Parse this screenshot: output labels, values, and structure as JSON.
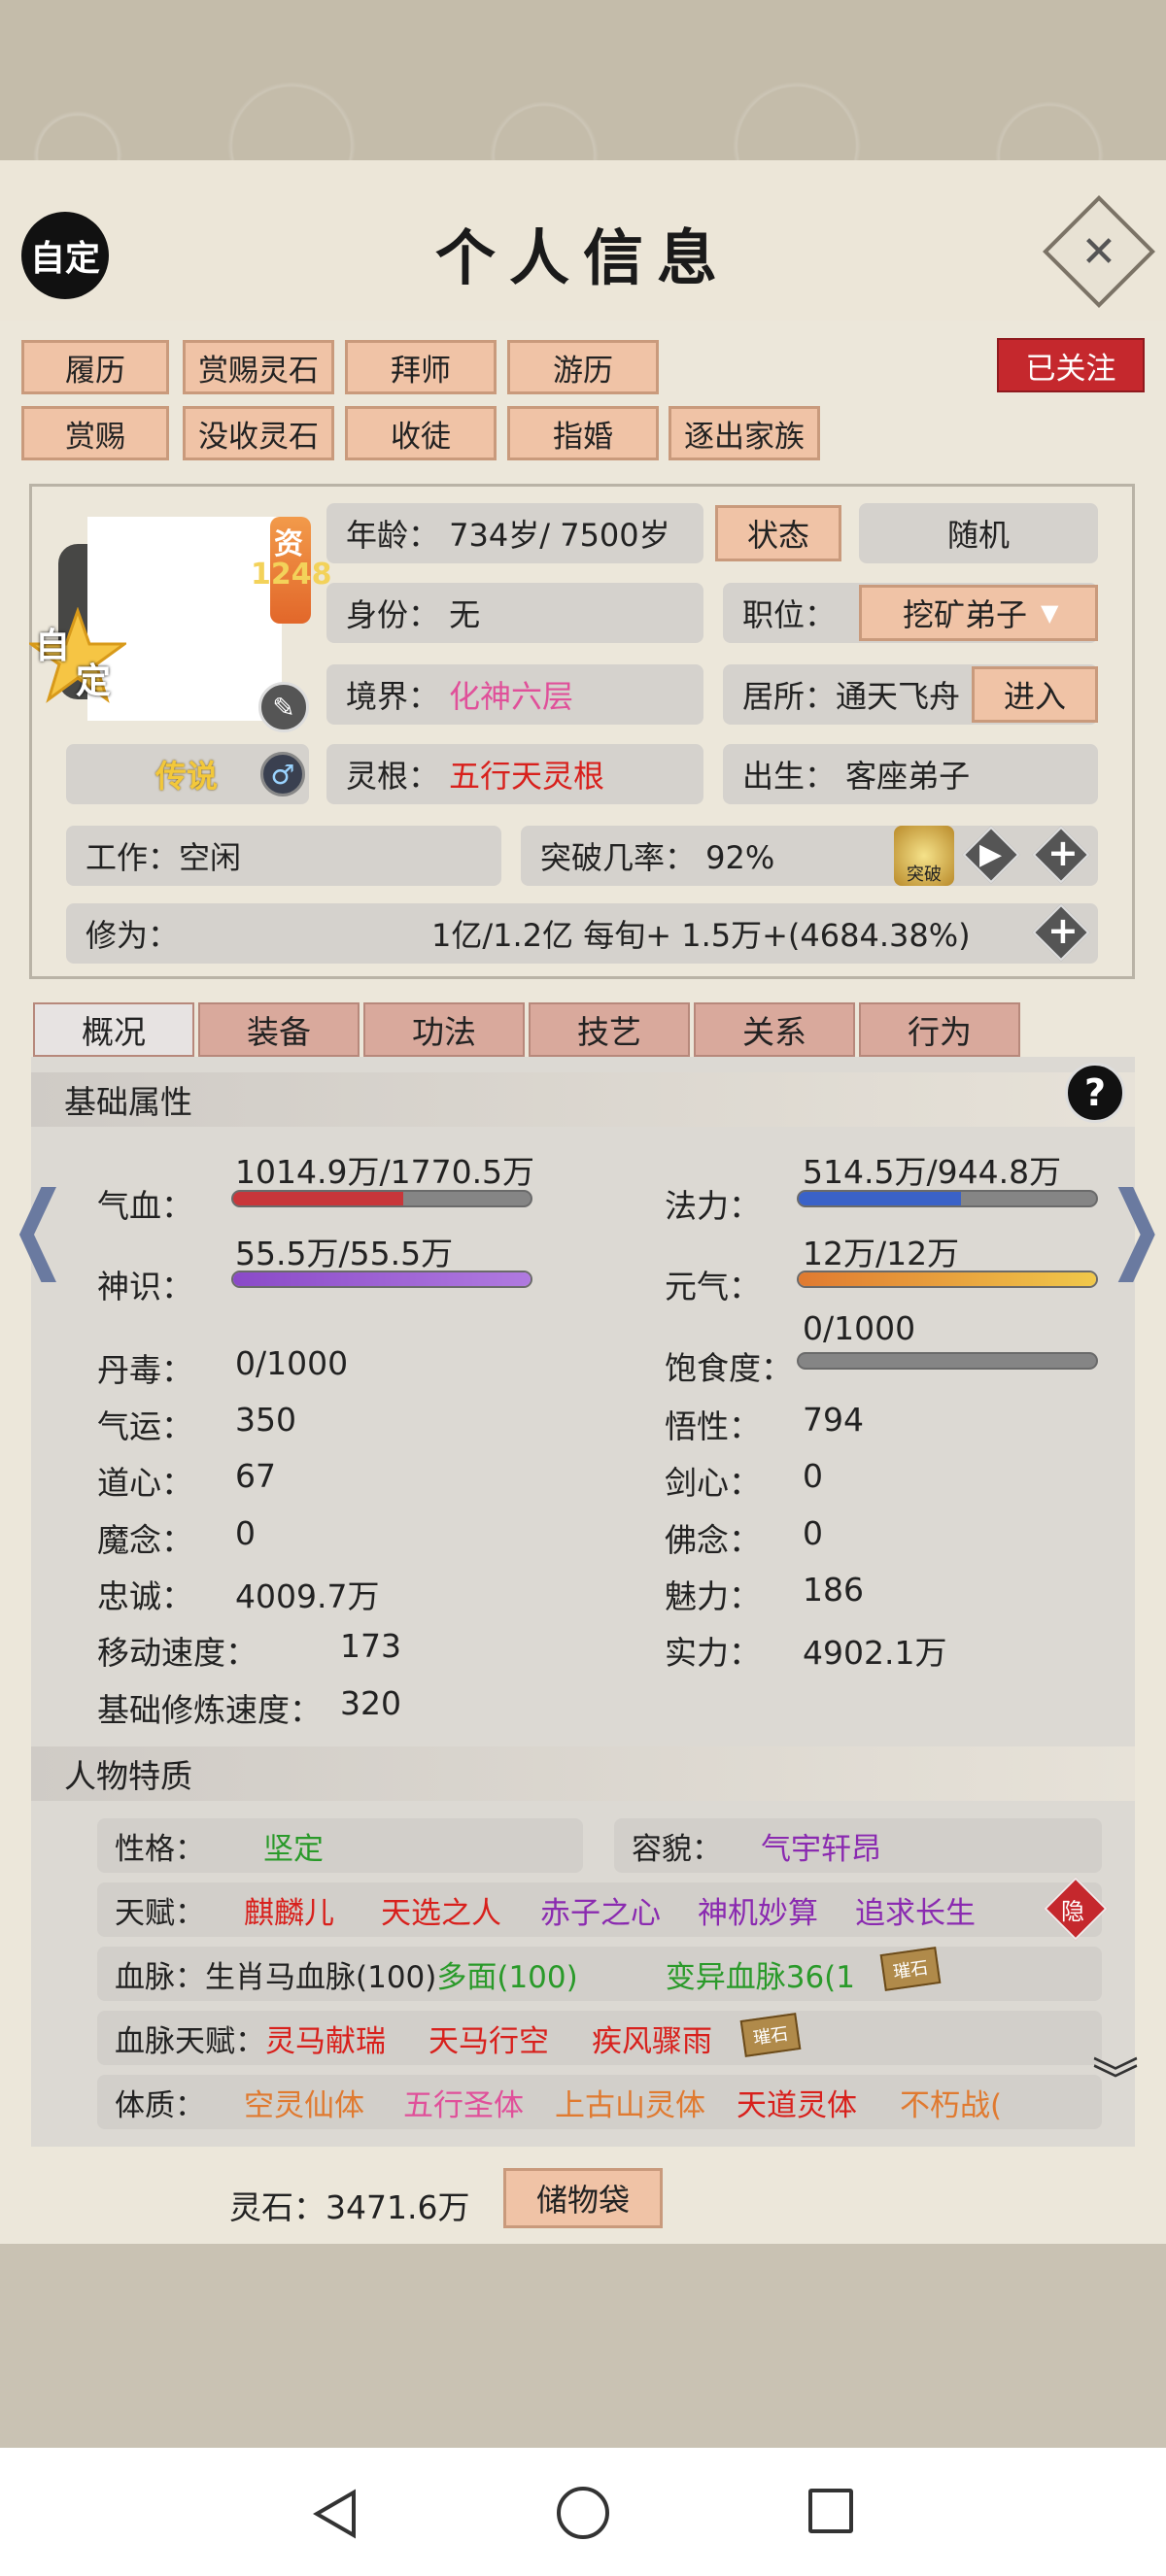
{
  "header": {
    "title": "个人信息",
    "auto_label": "自定"
  },
  "top_buttons": [
    "履历",
    "赏赐灵石",
    "拜师",
    "游历",
    "赏赐",
    "没收灵石",
    "收徒",
    "指婚",
    "逐出家族"
  ],
  "follow_label": "已关注",
  "avatar": {
    "zi_label": "资",
    "zi_value": "1248",
    "custom_line1": "自",
    "custom_line2": "定",
    "legend_label": "传说"
  },
  "info": {
    "age": "年龄：  734岁/ 7500岁",
    "status_btn": "状态",
    "random_btn": "随机",
    "identity": "身份：  无",
    "position_label": "职位：",
    "position_value": "挖矿弟子",
    "realm_label": "境界：",
    "realm_value": "化神六层",
    "residence": "居所：通天飞舟",
    "enter_btn": "进入",
    "root_label": "灵根：",
    "root_value": "五行天灵根",
    "birth": "出生：  客座弟子",
    "work": "工作：空闲",
    "breakthrough": "突破几率：  92%",
    "breakthrough_icon_label": "突破",
    "cultivation_label": "修为：",
    "cultivation_value": "1亿/1.2亿  每旬+  1.5万+(4684.38%)"
  },
  "tabs": [
    "概况",
    "装备",
    "功法",
    "技艺",
    "关系",
    "行为"
  ],
  "basic_attrs": {
    "section_title": "基础属性",
    "help": "?",
    "qixue_label": "气血：",
    "qixue_value": "1014.9万/1770.5万",
    "qixue_fraction": 0.573,
    "fali_label": "法力：",
    "fali_value": "514.5万/944.8万",
    "fali_fraction": 0.545,
    "shenshi_label": "神识：",
    "shenshi_value": "55.5万/55.5万",
    "shenshi_fraction": 1.0,
    "yuanqi_label": "元气：",
    "yuanqi_value": "12万/12万",
    "yuanqi_fraction": 1.0,
    "baoshi_label": "饱食度：",
    "baoshi_value": "0/1000",
    "baoshi_fraction": 0.0,
    "left_rows": [
      {
        "label": "丹毒：",
        "value": "0/1000"
      },
      {
        "label": "气运：",
        "value": "350"
      },
      {
        "label": "道心：",
        "value": "67"
      },
      {
        "label": "魔念：",
        "value": "0"
      },
      {
        "label": "忠诚：",
        "value": "4009.7万"
      },
      {
        "label": "移动速度：",
        "value": "173"
      },
      {
        "label": "基础修炼速度：",
        "value": "320"
      }
    ],
    "right_rows": [
      {
        "label": "悟性：",
        "value": "794"
      },
      {
        "label": "剑心：",
        "value": "0"
      },
      {
        "label": "佛念：",
        "value": "0"
      },
      {
        "label": "魅力：",
        "value": "186"
      },
      {
        "label": "实力：",
        "value": "4902.1万"
      }
    ]
  },
  "traits": {
    "section_title": "人物特质",
    "personality_label": "性格：",
    "personality_value": "坚定",
    "looks_label": "容貌：",
    "looks_value": "气宇轩昂",
    "talent_label": "天赋：",
    "talents": [
      "麒麟儿",
      "天选之人",
      "赤子之心",
      "神机妙算",
      "追求长生"
    ],
    "hide_label": "隐",
    "blood_label": "血脉：",
    "blood_value": "生肖马血脉(100)",
    "blood_value2": "多面(100)",
    "blood_variant": "变异血脉36(1",
    "blood_tag": "璀石",
    "blood_talent_label": "血脉天赋：",
    "blood_talents": [
      "灵马献瑞",
      "天马行空",
      "疾风骤雨"
    ],
    "body_label": "体质：",
    "bodies": [
      "空灵仙体",
      "五行圣体",
      "上古山灵体",
      "天道灵体",
      "不朽战("
    ]
  },
  "footer": {
    "spirit_stone": "灵石：3471.6万",
    "bag_btn": "储物袋"
  },
  "colors": {
    "pink": "#e0509a",
    "red": "#d8201c",
    "green": "#2a9a2a",
    "purple": "#8a2ab0",
    "orange": "#e07a30",
    "gold": "#f3d25a"
  }
}
